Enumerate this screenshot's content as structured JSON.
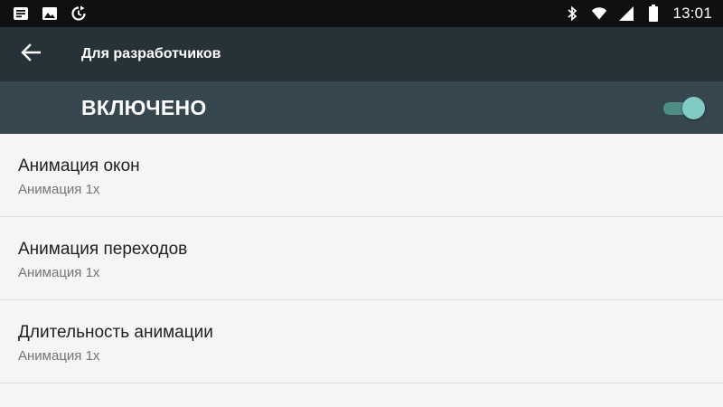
{
  "status_bar": {
    "time": "13:01",
    "left_icons": [
      "notification-icon",
      "image-icon",
      "sync-icon"
    ],
    "right_icons": [
      "bluetooth-icon",
      "wifi-icon",
      "signal-icon",
      "battery-icon"
    ]
  },
  "toolbar": {
    "title": "Для разработчиков",
    "back_icon": "arrow-back-icon",
    "background": "#263238"
  },
  "master_switch": {
    "label": "ВКЛЮЧЕНО",
    "state": "on",
    "accent": "#80cbc4",
    "background": "#37474f"
  },
  "settings": [
    {
      "title": "Анимация окон",
      "summary": "Анимация 1x"
    },
    {
      "title": "Анимация переходов",
      "summary": "Анимация 1x"
    },
    {
      "title": "Длительность анимации",
      "summary": "Анимация 1x"
    }
  ]
}
